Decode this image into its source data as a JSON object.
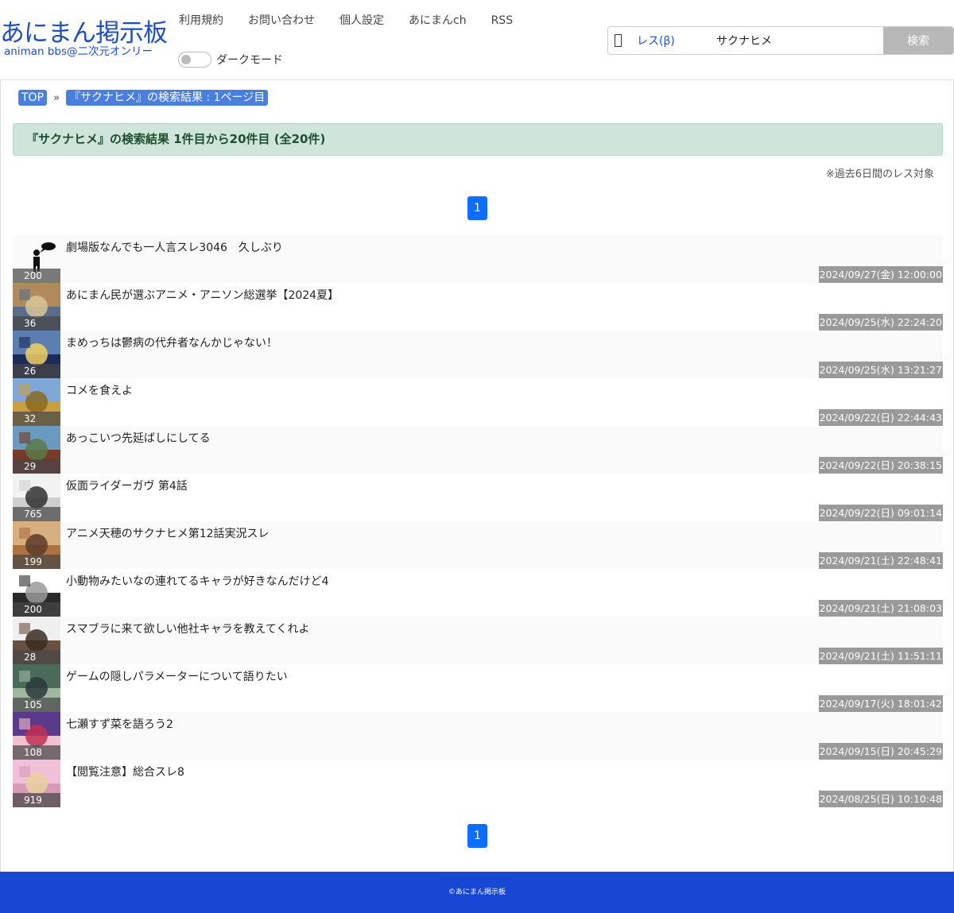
{
  "header": {
    "logo_main": "あにまん掲示板",
    "logo_sub": "animan bbs@二次元オンリー",
    "nav": [
      "利用規約",
      "お問い合わせ",
      "個人設定",
      "あにまんch",
      "RSS"
    ],
    "dark_mode_label": "ダークモード",
    "search": {
      "type_label": "レス(β)",
      "value": "サクナヒメ",
      "button": "検索"
    }
  },
  "breadcrumb": {
    "top": "TOP",
    "separator": "»",
    "current": "『サクナヒメ』の検索結果 : 1ページ目"
  },
  "result_header": "『サクナヒメ』の検索結果 1件目から20件目 (全20件)",
  "note": "※過去6日間のレス対象",
  "pagination": {
    "current": "1"
  },
  "threads": [
    {
      "title": "劇場版なんでも一人言スレ3046　久しぶり",
      "count": "200",
      "date": "2024/09/27(金) 12:00:00",
      "thumb": "speech-figure",
      "colors": [
        "#ffffff",
        "#ffffff",
        "#ffffff"
      ]
    },
    {
      "title": "あにまん民が選ぶアニメ・アニソン総選挙【2024夏】",
      "count": "36",
      "date": "2024/09/25(水) 22:24:20",
      "thumb": "anime-collage",
      "colors": [
        "#b08a5a",
        "#5a6e8a",
        "#d8c59a"
      ]
    },
    {
      "title": "まめっちは鬱病の代弁者なんかじゃない！",
      "count": "26",
      "date": "2024/09/25(水) 13:21:27",
      "thumb": "mametchi",
      "colors": [
        "#5a7fb0",
        "#1d2a5a",
        "#f0d060"
      ]
    },
    {
      "title": "コメを食えよ",
      "count": "32",
      "date": "2024/09/22(日) 22:44:43",
      "thumb": "rice-field",
      "colors": [
        "#7fa7d8",
        "#c9a040",
        "#8a6a20"
      ]
    },
    {
      "title": "あっこいつ先延ばしにしてる",
      "count": "29",
      "date": "2024/09/22(日) 20:38:15",
      "thumb": "anime-girl",
      "colors": [
        "#6a9ac0",
        "#7a3a2a",
        "#5a7a4a"
      ]
    },
    {
      "title": "仮面ライダーガヴ 第4話",
      "count": "765",
      "date": "2024/09/22(日) 09:01:14",
      "thumb": "white-creature",
      "colors": [
        "#f2f2f2",
        "#d0d0d0",
        "#303030"
      ]
    },
    {
      "title": "アニメ天穂のサクナヒメ第12話実況スレ",
      "count": "199",
      "date": "2024/09/21(土) 22:48:41",
      "thumb": "sakuna-poster",
      "colors": [
        "#d8b080",
        "#b07040",
        "#5a3a2a"
      ]
    },
    {
      "title": "小動物みたいなの連れてるキャラが好きなんだけど4",
      "count": "200",
      "date": "2024/09/21(土) 21:08:03",
      "thumb": "pirate-flag",
      "colors": [
        "#ffffff",
        "#2a2a2a",
        "#9a9a9a"
      ]
    },
    {
      "title": "スマブラに来て欲しい他社キャラを教えてくれよ",
      "count": "28",
      "date": "2024/09/21(土) 11:51:11",
      "thumb": "bald-man",
      "colors": [
        "#f0f0f0",
        "#6a5040",
        "#3a2a20"
      ]
    },
    {
      "title": "ゲームの隠しパラメーターについて語りたい",
      "count": "105",
      "date": "2024/09/17(火) 18:01:42",
      "thumb": "game-screen",
      "colors": [
        "#4a6a5a",
        "#a0b8a0",
        "#2a3a3a"
      ]
    },
    {
      "title": "七瀬すず菜を語ろう2",
      "count": "108",
      "date": "2024/09/15(日) 20:45:29",
      "thumb": "purple-hair-girl",
      "colors": [
        "#5a3a8a",
        "#f0c0d0",
        "#c03050"
      ]
    },
    {
      "title": "【閲覧注意】総合スレ8",
      "count": "919",
      "date": "2024/08/25(日) 10:10:48",
      "thumb": "pink-cartoon",
      "colors": [
        "#f0c0d8",
        "#d89ab8",
        "#e8d0a0"
      ]
    }
  ],
  "footer": "©あにまん掲示板",
  "colors": {
    "brand": "#1e4fbf",
    "footer": "#1847d4",
    "crumb": "#4a7fdc",
    "pager": "#0d6efd",
    "result_bg": "#cfe5dc"
  }
}
